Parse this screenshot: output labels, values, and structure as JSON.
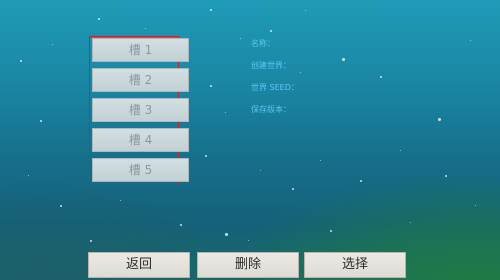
{
  "slots": [
    {
      "label": "槽 1"
    },
    {
      "label": "槽 2"
    },
    {
      "label": "槽 3"
    },
    {
      "label": "槽 4"
    },
    {
      "label": "槽 5"
    }
  ],
  "info": {
    "name_label": "名称：",
    "created_world_label": "创建世界：",
    "world_seed_label": "世界 SEED：",
    "save_version_label": "保存版本："
  },
  "actions": {
    "back_label": "返回",
    "delete_label": "删除",
    "select_label": "选择"
  },
  "colors": {
    "info_text": "#5ec6f2",
    "selection_border": "#c0282e"
  }
}
